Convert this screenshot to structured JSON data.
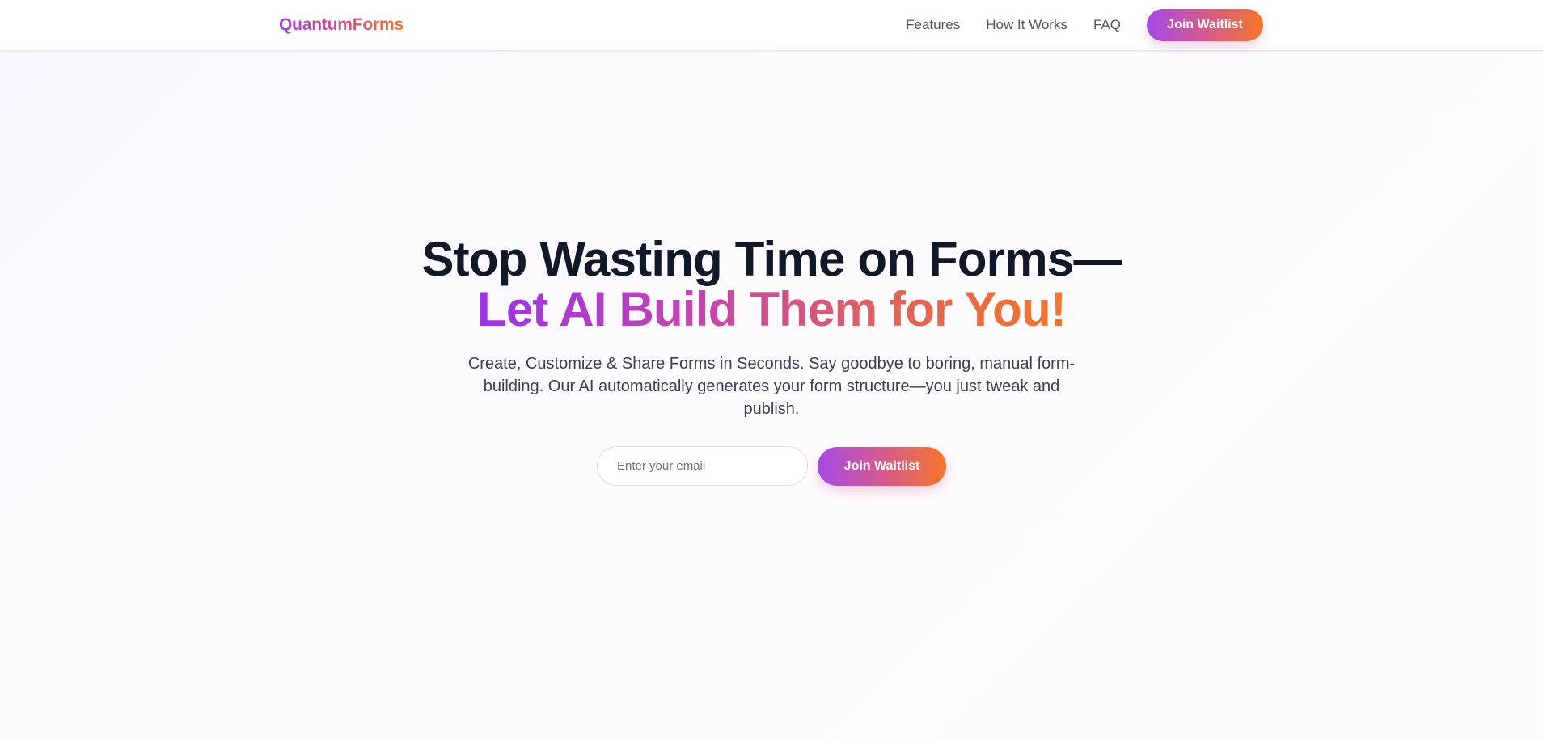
{
  "brand": {
    "name": "QuantumForms"
  },
  "nav": {
    "links": [
      {
        "label": "Features"
      },
      {
        "label": "How It Works"
      },
      {
        "label": "FAQ"
      }
    ],
    "cta_label": "Join Waitlist"
  },
  "hero": {
    "headline_line1": "Stop Wasting Time on Forms—",
    "headline_line2": "Let AI Build Them for You!",
    "subtitle": "Create, Customize & Share Forms in Seconds. Say goodbye to boring, manual form-building. Our AI automatically generates your form structure—you just tweak and publish.",
    "email_placeholder": "Enter your email",
    "email_value": "",
    "cta_label": "Join Waitlist"
  },
  "colors": {
    "gradient_start": "#a64ae6",
    "gradient_mid": "#d45a8e",
    "gradient_end": "#f5762a",
    "text_dark": "#111827",
    "text_muted": "#4b5563"
  }
}
